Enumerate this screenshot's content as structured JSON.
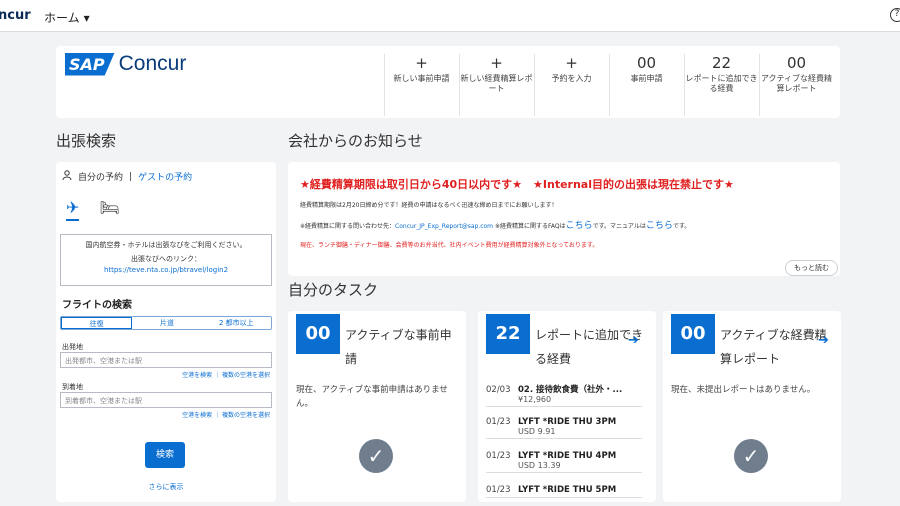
{
  "topbar": {
    "brand": "ncur",
    "home": "ホーム",
    "help": "?"
  },
  "logo": {
    "sap": "SAP",
    "name": "Concur"
  },
  "quick_actions": [
    {
      "big": "+",
      "label": "新しい事前申請"
    },
    {
      "big": "+",
      "label": "新しい経費精算レポート"
    },
    {
      "big": "+",
      "label": "予約を入力"
    },
    {
      "big": "00",
      "label": "事前申請"
    },
    {
      "big": "22",
      "label": "レポートに追加できる経費"
    },
    {
      "big": "00",
      "label": "アクティブな経費精算レポート"
    }
  ],
  "trip": {
    "title": "出張検索",
    "my_booking": "自分の予約",
    "guest_booking": "ゲストの予約",
    "notice_line1": "国内航空券・ホテルは出張なびをご利用ください。",
    "notice_line2": "出張なびへのリンク：",
    "notice_link": "https://teve.nta.co.jp/btravel/login2",
    "flight_search": "フライトの検索",
    "seg": [
      "往復",
      "片道",
      "2 都市以上"
    ],
    "from_label": "出発地",
    "from_placeholder": "出発都市、空港または駅",
    "to_label": "到着地",
    "to_placeholder": "到着都市、空港または駅",
    "field_links": "空港を検索 ｜ 複数の空港を選択",
    "search_button": "検索",
    "more": "さらに表示"
  },
  "news": {
    "title": "会社からのお知らせ",
    "headline": "★経費精算期限は取引日から40日以内です★　★Internal目的の出張は現在禁止です★",
    "line1": "経費精算期限は2月20日締め分です！経費の申請はなるべく迅速な締め日までにお願いします！",
    "line2_a": "※経費精算に関する問い合わせ先：",
    "line2_email": "Concur_JP_Exp_Report@sap.com",
    "line2_b": " ※経費精算に関するFAQは",
    "line2_link1": "こちら",
    "line2_c": "です。マニュアルは",
    "line2_link2": "こちら",
    "line2_d": "です。",
    "line3": "現在、ランチ御膳・ディナー御膳、会費等のお弁当代、社内イベント費用が経費精算対象外となっております。",
    "more": "もっと読む"
  },
  "tasks": {
    "title": "自分のタスク",
    "cards": [
      {
        "count": "00",
        "title": "アクティブな事前申請",
        "msg": "現在、アクティブな事前申請はありません。"
      },
      {
        "count": "22",
        "title": "レポートに追加できる経費"
      },
      {
        "count": "00",
        "title": "アクティブな経費精算レポート",
        "msg": "現在、未提出レポートはありません。"
      }
    ],
    "expenses": [
      {
        "date": "02/03",
        "name": "02. 接待飲食費（社外・...",
        "amount": "¥12,960"
      },
      {
        "date": "01/23",
        "name": "LYFT *RIDE THU 3PM",
        "amount": "USD 9.91"
      },
      {
        "date": "01/23",
        "name": "LYFT *RIDE THU 4PM",
        "amount": "USD 13.39"
      },
      {
        "date": "01/23",
        "name": "LYFT *RIDE THU 5PM",
        "amount": ""
      }
    ]
  },
  "icons": {
    "user": "user-icon",
    "plane": "plane-icon",
    "hotel": "hotel-icon",
    "check": "check-icon",
    "arrow": "arrow-right-icon"
  },
  "colors": {
    "accent": "#0a6ed1",
    "alert": "#e02020"
  }
}
